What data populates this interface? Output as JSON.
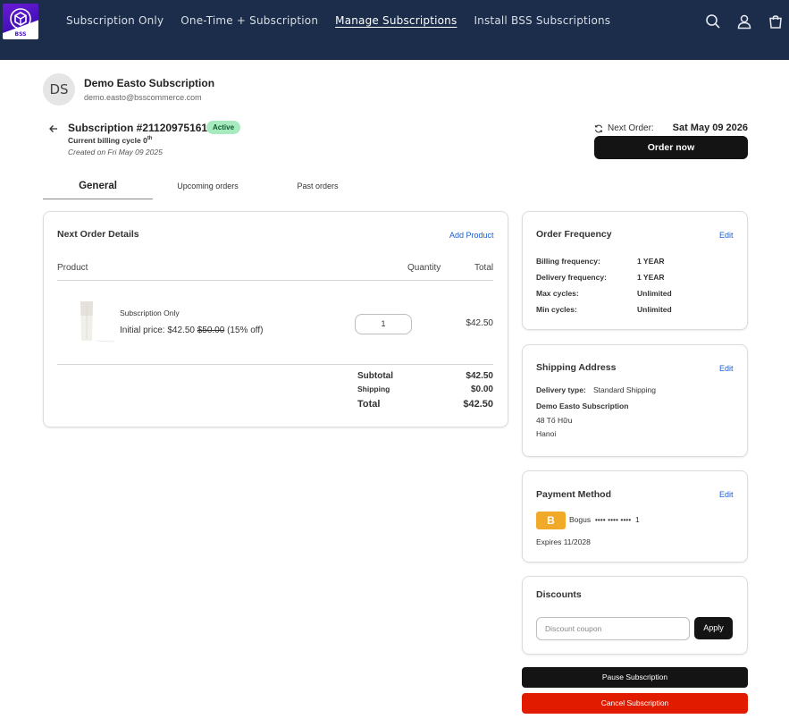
{
  "header": {
    "logo_text": "BSS",
    "nav": [
      {
        "label": "Subscription Only"
      },
      {
        "label": "One-Time + Subscription"
      },
      {
        "label": "Manage Subscriptions"
      },
      {
        "label": "Install BSS Subscriptions"
      }
    ],
    "icons": [
      "search-icon",
      "account-icon",
      "cart-icon"
    ],
    "bg_color": "#1b2d4a"
  },
  "customer": {
    "initials": "DS",
    "name": "Demo Easto Subscription",
    "email": "demo.easto@bsscommerce.com"
  },
  "subscription": {
    "title": "Subscription #21120975161",
    "status": "Active",
    "billing_cycle_label": "Current billing cycle 0",
    "billing_cycle_suffix": "th",
    "created": "Created on Fri May 09 2025",
    "next_order_label": "Next Order:",
    "next_order_date": "Sat May 09 2026",
    "order_now_label": "Order now"
  },
  "tabs": [
    {
      "label": "General"
    },
    {
      "label": "Upcoming orders"
    },
    {
      "label": "Past orders"
    }
  ],
  "next_order": {
    "title": "Next Order Details",
    "add_product_label": "Add Product",
    "columns": {
      "product": "Product",
      "quantity": "Quantity",
      "total": "Total"
    },
    "item": {
      "name": "Subscription Only",
      "price_prefix": "Initial price: $42.50 ",
      "original_price": "$50.00",
      "discount": " (15% off)",
      "quantity": "1",
      "total": "$42.50"
    },
    "summary": {
      "subtotal_label": "Subtotal",
      "subtotal": "$42.50",
      "shipping_label": "Shipping",
      "shipping": "$0.00",
      "total_label": "Total",
      "total": "$42.50"
    }
  },
  "order_frequency": {
    "title": "Order Frequency",
    "edit_label": "Edit",
    "rows": [
      {
        "key": "Billing frequency:",
        "value": "1 YEAR"
      },
      {
        "key": "Delivery frequency:",
        "value": "1 YEAR"
      },
      {
        "key": "Max cycles:",
        "value": "Unlimited"
      },
      {
        "key": "Min cycles:",
        "value": "Unlimited"
      }
    ]
  },
  "shipping": {
    "title": "Shipping Address",
    "edit_label": "Edit",
    "delivery_type_label": "Delivery type:",
    "delivery_type": "Standard Shipping",
    "name": "Demo Easto Subscription",
    "address1": "48 Tố Hữu",
    "city": "Hanoi"
  },
  "payment": {
    "title": "Payment Method",
    "edit_label": "Edit",
    "card_brand_letter": "B",
    "card_text": "Bogus  •••• •••• ••••  1",
    "expires": "Expires 11/2028"
  },
  "discounts": {
    "title": "Discounts",
    "placeholder": "Discount coupon",
    "apply_label": "Apply"
  },
  "actions": {
    "pause_label": "Pause Subscription",
    "cancel_label": "Cancel Subscription"
  }
}
